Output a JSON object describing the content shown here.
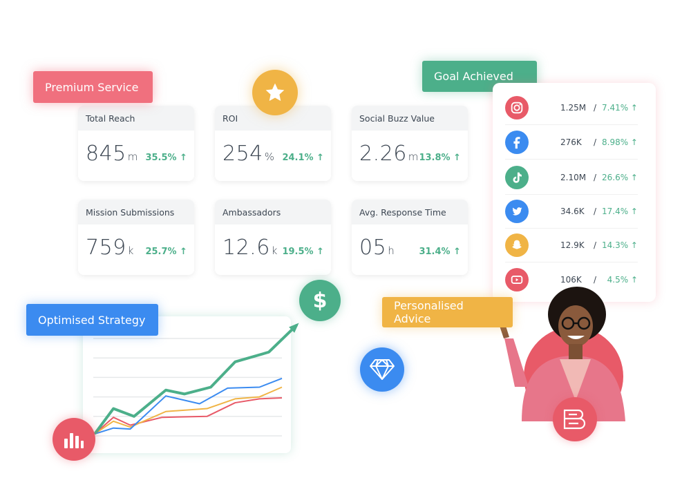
{
  "tags": {
    "premium": "Premium Service",
    "goal": "Goal Achieved",
    "strategy": "Optimised Strategy",
    "advice": "Personalised Advice"
  },
  "colors": {
    "pink": "#f0707e",
    "green": "#4caf8a",
    "blue": "#3b8bf0",
    "amber": "#f0b445",
    "red": "#e85a68"
  },
  "metrics": [
    {
      "label": "Total Reach",
      "value": "845",
      "unit": "m",
      "change": "35.5% ↑"
    },
    {
      "label": "ROI",
      "value": "254",
      "unit": "%",
      "change": "24.1% ↑"
    },
    {
      "label": "Social Buzz Value",
      "value": "2.26",
      "unit": "m",
      "change": "13.8% ↑"
    },
    {
      "label": "Mission Submissions",
      "value": "759",
      "unit": "k",
      "change": "25.7% ↑"
    },
    {
      "label": "Ambassadors",
      "value": "12.6",
      "unit": "k",
      "change": "19.5% ↑"
    },
    {
      "label": "Avg. Response Time",
      "value": "05",
      "unit": "h",
      "change": "31.4% ↑"
    }
  ],
  "social": [
    {
      "icon": "instagram-icon",
      "color": "#e85a68",
      "count": "1.25M",
      "sep": "/",
      "change": "7.41% ↑"
    },
    {
      "icon": "facebook-icon",
      "color": "#3b8bf0",
      "count": "276K",
      "sep": "/",
      "change": "8.98% ↑"
    },
    {
      "icon": "tiktok-icon",
      "color": "#4caf8a",
      "count": "2.10M",
      "sep": "/",
      "change": "26.6% ↑"
    },
    {
      "icon": "twitter-icon",
      "color": "#3b8bf0",
      "count": "34.6K",
      "sep": "/",
      "change": "17.4% ↑"
    },
    {
      "icon": "snapchat-icon",
      "color": "#f0b445",
      "count": "12.9K",
      "sep": "/",
      "change": "14.3% ↑"
    },
    {
      "icon": "youtube-icon",
      "color": "#e85a68",
      "count": "106K",
      "sep": "/",
      "change": "4.5% ↑"
    }
  ],
  "chart_data": {
    "type": "line",
    "grid": true,
    "series": [
      {
        "color": "#4caf8a",
        "x": [
          0,
          10,
          21,
          38,
          48,
          62,
          75,
          93,
          108
        ],
        "y": [
          2,
          28,
          20,
          47,
          43,
          50,
          76,
          86,
          114
        ]
      },
      {
        "color": "#3b8bf0",
        "x": [
          0,
          10,
          19,
          38,
          56,
          71,
          88,
          100
        ],
        "y": [
          2,
          8,
          7,
          41,
          33,
          49,
          50,
          59
        ]
      },
      {
        "color": "#f0b445",
        "x": [
          0,
          10,
          19,
          38,
          60,
          75,
          88,
          100
        ],
        "y": [
          2,
          15,
          9,
          25,
          28,
          38,
          40,
          50
        ]
      },
      {
        "color": "#e85a68",
        "x": [
          0,
          10,
          19,
          36,
          60,
          75,
          88,
          100
        ],
        "y": [
          2,
          19,
          11,
          19,
          20,
          34,
          38,
          39
        ]
      }
    ]
  },
  "icons": {
    "star": "star-icon",
    "dollar": "$",
    "diamond": "diamond-icon",
    "bars": "bar-chart-icon",
    "logo": "brand-logo"
  }
}
